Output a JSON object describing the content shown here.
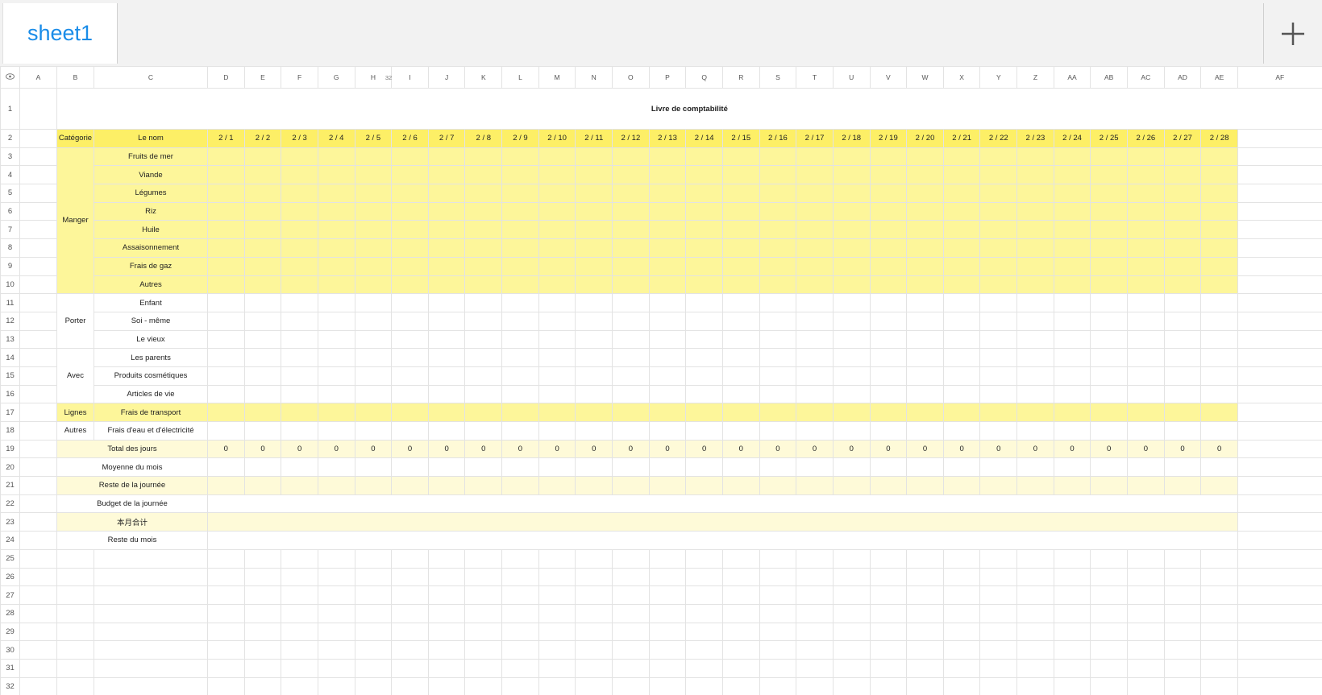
{
  "tab": {
    "name": "sheet1"
  },
  "icons": {
    "add": "plus-icon",
    "corner": "eye-icon"
  },
  "colors": {
    "tab_text": "#1a8ce8",
    "header_yellow": "#fdef66",
    "body_yellow": "#fdf69a",
    "light_yellow": "#fefad8",
    "border": "#8f93b8"
  },
  "columns": [
    "A",
    "B",
    "C",
    "D",
    "E",
    "F",
    "G",
    "H",
    "I",
    "J",
    "K",
    "L",
    "M",
    "N",
    "O",
    "P",
    "Q",
    "R",
    "S",
    "T",
    "U",
    "V",
    "W",
    "X",
    "Y",
    "Z",
    "AA",
    "AB",
    "AC",
    "AD",
    "AE",
    "AF"
  ],
  "header_marker": "32",
  "row_numbers": [
    "1",
    "2",
    "3",
    "4",
    "5",
    "6",
    "7",
    "8",
    "9",
    "10",
    "11",
    "12",
    "13",
    "14",
    "15",
    "16",
    "17",
    "18",
    "19",
    "20",
    "21",
    "22",
    "23",
    "24",
    "25",
    "26",
    "27",
    "28",
    "29",
    "30",
    "31",
    "32"
  ],
  "ledger": {
    "title": "Livre de comptabilité",
    "header_category": "Catégorie",
    "header_name": "Le nom",
    "dates": [
      "2 / 1",
      "2 / 2",
      "2 / 3",
      "2 / 4",
      "2 / 5",
      "2 / 6",
      "2 / 7",
      "2 / 8",
      "2 / 9",
      "2 / 10",
      "2 / 11",
      "2 / 12",
      "2 / 13",
      "2 / 14",
      "2 / 15",
      "2 / 16",
      "2 / 17",
      "2 / 18",
      "2 / 19",
      "2 / 20",
      "2 / 21",
      "2 / 22",
      "2 / 23",
      "2 / 24",
      "2 / 25",
      "2 / 26",
      "2 / 27",
      "2 / 28"
    ],
    "groups": [
      {
        "category": "Manger",
        "style": "y",
        "items": [
          "Fruits de mer",
          "Viande",
          "Légumes",
          "Riz",
          "Huile",
          "Assaisonnement",
          "Frais de gaz",
          "Autres"
        ]
      },
      {
        "category": "Porter",
        "style": "w",
        "items": [
          "Enfant",
          "Soi - même",
          "Le vieux"
        ]
      },
      {
        "category": "Avec",
        "style": "w",
        "items": [
          "Les parents",
          "Produits cosmétiques",
          "Articles de vie"
        ]
      },
      {
        "category": "Lignes",
        "style": "y",
        "items": [
          "Frais de transport"
        ]
      },
      {
        "category": "Autres",
        "style": "w",
        "items": [
          "Frais d'eau et d'électricité"
        ]
      }
    ],
    "total_label": "Total des jours",
    "total_values": [
      "0",
      "0",
      "0",
      "0",
      "0",
      "0",
      "0",
      "0",
      "0",
      "0",
      "0",
      "0",
      "0",
      "0",
      "0",
      "0",
      "0",
      "0",
      "0",
      "0",
      "0",
      "0",
      "0",
      "0",
      "0",
      "0",
      "0",
      "0"
    ],
    "summary_rows": [
      {
        "label": "Moyenne du mois",
        "style": "w",
        "merged": false
      },
      {
        "label": "Reste de la journée",
        "style": "ly",
        "merged": false
      },
      {
        "label": "Budget de la journée",
        "style": "w",
        "merged": true
      },
      {
        "label": "本月合计",
        "style": "ly",
        "merged": true
      },
      {
        "label": "Reste du mois",
        "style": "w",
        "merged": true
      }
    ]
  }
}
